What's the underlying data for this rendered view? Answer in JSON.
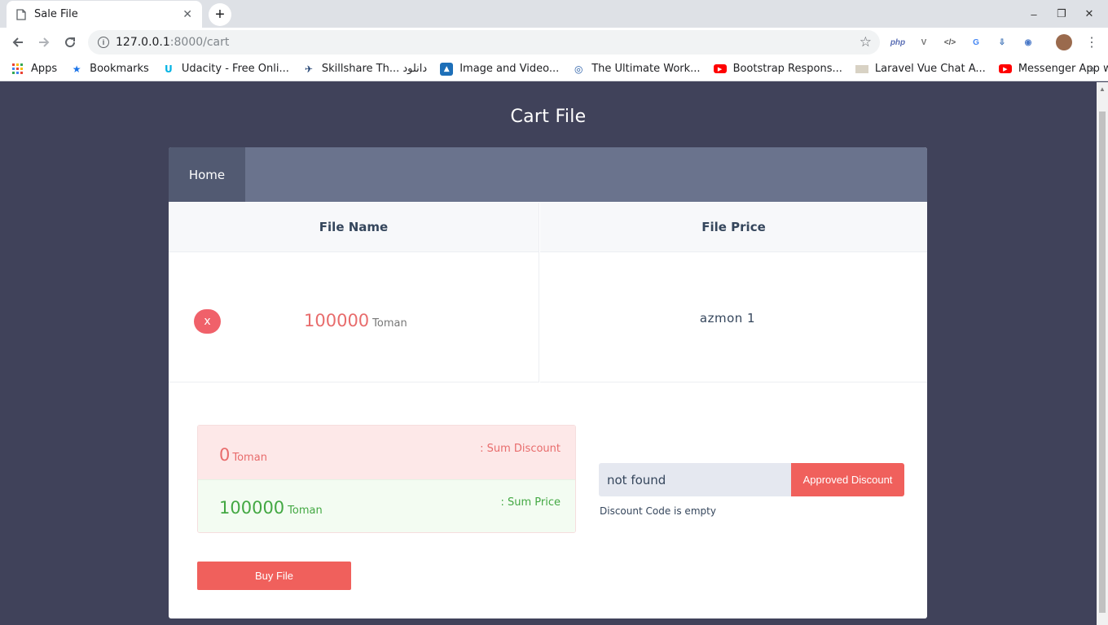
{
  "browser": {
    "tab_title": "Sale File",
    "tab_close": "✕",
    "new_tab": "+",
    "url_host": "127.0.0.1",
    "url_path": ":8000/cart",
    "window_controls": [
      "–",
      "❐",
      "✕"
    ],
    "extensions": [
      "php",
      "V",
      "</>",
      "G",
      "⇩",
      "◉"
    ],
    "bookmarks": [
      {
        "label": "Apps",
        "icon": "apps-grid-icon"
      },
      {
        "label": "Bookmarks",
        "icon": "star-icon"
      },
      {
        "label": "Udacity - Free Onli...",
        "icon": "udacity-icon"
      },
      {
        "label": "Skillshare Th... دانلود",
        "icon": "skillshare-icon"
      },
      {
        "label": "Image and Video...",
        "icon": "image-icon"
      },
      {
        "label": "The Ultimate Work...",
        "icon": "globe-icon"
      },
      {
        "label": "Bootstrap Respons...",
        "icon": "youtube-icon"
      },
      {
        "label": "Laravel Vue Chat A...",
        "icon": "page-icon"
      },
      {
        "label": "Messenger App wi...",
        "icon": "youtube-icon"
      }
    ],
    "bookmarks_more": "»"
  },
  "page": {
    "title": "Cart File",
    "nav": {
      "home": "Home"
    },
    "table": {
      "headers": [
        "File Name",
        "File Price"
      ],
      "rows": [
        {
          "remove": "x",
          "price": "100000",
          "unit": "Toman",
          "name": "azmon 1"
        }
      ]
    },
    "summary": {
      "discount_value": "0",
      "discount_unit": "Toman",
      "discount_label": ": Sum Discount",
      "price_value": "100000",
      "price_unit": "Toman",
      "price_label": ": Sum Price"
    },
    "discount": {
      "input_value": "not found",
      "button": "Approved Discount",
      "message": "Discount Code is empty"
    },
    "buy_button": "Buy File"
  },
  "colors": {
    "page_bg": "#40425a",
    "nav_bg": "#6a738d",
    "accent_red": "#f0605c",
    "green": "#43a843"
  }
}
